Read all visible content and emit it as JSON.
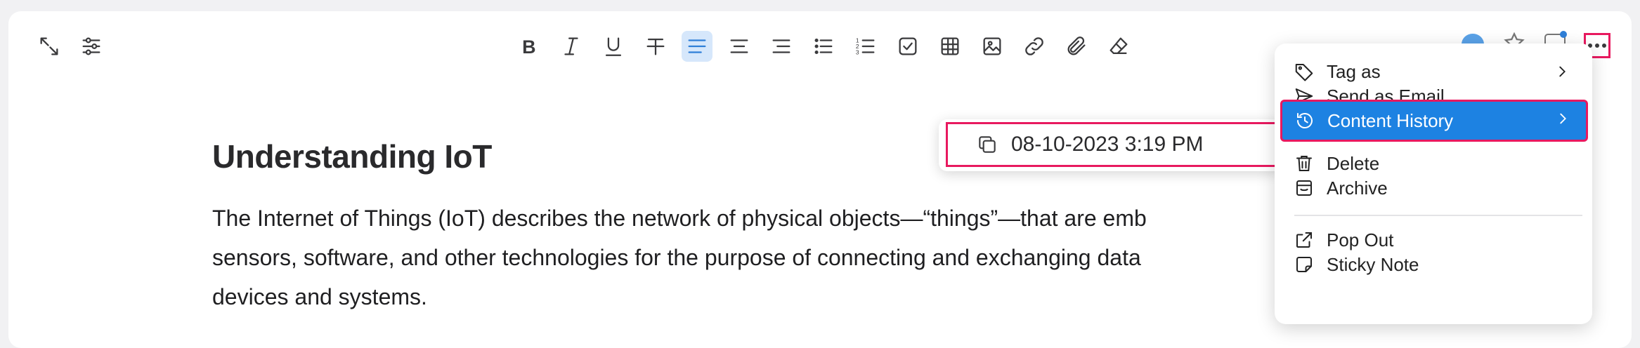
{
  "toolbar": {
    "left": [
      {
        "name": "expand-icon"
      },
      {
        "name": "sliders-icon"
      }
    ],
    "format": [
      {
        "name": "bold-icon"
      },
      {
        "name": "italic-icon"
      },
      {
        "name": "underline-icon"
      },
      {
        "name": "strikethrough-icon"
      },
      {
        "name": "align-left-icon",
        "active": true
      },
      {
        "name": "align-center-icon"
      },
      {
        "name": "align-right-icon"
      },
      {
        "name": "bullet-list-icon"
      },
      {
        "name": "numbered-list-icon"
      },
      {
        "name": "checklist-icon"
      },
      {
        "name": "table-icon"
      },
      {
        "name": "image-icon"
      },
      {
        "name": "link-icon"
      },
      {
        "name": "attachment-icon"
      },
      {
        "name": "eraser-icon"
      }
    ],
    "more": {
      "name": "more-options-icon"
    }
  },
  "note": {
    "title": "Understanding IoT",
    "body_lines": [
      "The Internet of Things (IoT) describes the network of physical objects—“things”—that are emb",
      "sensors, software, and other technologies for the purpose of connecting and exchanging data",
      "devices and systems."
    ]
  },
  "history_popup": {
    "entry_date": "08-10-2023 3:19 PM",
    "icon": "copy-icon"
  },
  "menu": {
    "items": [
      {
        "label": "Tag as",
        "icon": "tag-icon",
        "has_submenu": true
      },
      {
        "label": "Send as Email",
        "icon": "send-icon"
      },
      {
        "label": "Content History",
        "icon": "history-icon",
        "has_submenu": true,
        "highlighted": true
      },
      {
        "label": "Delete",
        "icon": "trash-icon"
      },
      {
        "label": "Archive",
        "icon": "archive-icon"
      },
      {
        "label": "Pop Out",
        "icon": "external-link-icon"
      },
      {
        "label": "Sticky Note",
        "icon": "sticky-note-icon"
      }
    ]
  },
  "colors": {
    "accent": "#1d82e2",
    "annotation": "#e8195f",
    "active_tool": "#d6e7fb"
  }
}
